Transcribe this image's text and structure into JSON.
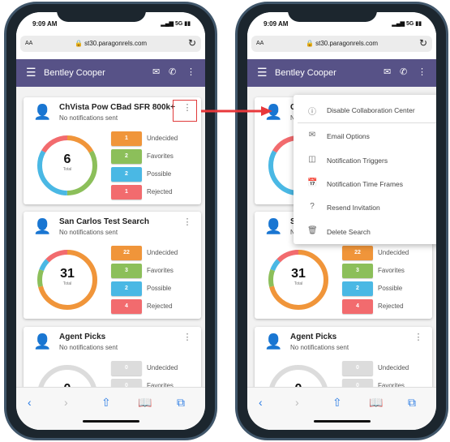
{
  "status": {
    "time": "9:09 AM",
    "signal": "5G"
  },
  "browser": {
    "text_size": "AA",
    "url": "st30.paragonrels.com",
    "icons": [
      "lock-icon",
      "reload-icon",
      "back-icon",
      "forward-icon",
      "share-icon",
      "bookmarks-icon",
      "tabs-icon"
    ]
  },
  "appbar": {
    "title": "Bentley Cooper",
    "icons": [
      "menu-icon",
      "mail-icon",
      "phone-icon",
      "more-icon"
    ]
  },
  "colors": {
    "header": "#575287",
    "undecided": "#f0953a",
    "favorites": "#8cbf5a",
    "possible": "#4ab8e4",
    "rejected": "#f26b6e",
    "empty": "#dcdcdc",
    "highlight": "#e03b3b"
  },
  "cards": [
    {
      "name": "ChVista Pow CBad SFR 800k+",
      "sub": "No notifications sent",
      "total": "6",
      "total_label": "Total",
      "stats": [
        {
          "label": "Undecided",
          "value": 1
        },
        {
          "label": "Favorites",
          "value": 2
        },
        {
          "label": "Possible",
          "value": 2
        },
        {
          "label": "Rejected",
          "value": 1
        }
      ]
    },
    {
      "name": "San Carlos Test Search",
      "sub": "No notifications sent",
      "total": "31",
      "total_label": "Total",
      "stats": [
        {
          "label": "Undecided",
          "value": 22
        },
        {
          "label": "Favorites",
          "value": 3
        },
        {
          "label": "Possible",
          "value": 2
        },
        {
          "label": "Rejected",
          "value": 4
        }
      ]
    },
    {
      "name": "Agent Picks",
      "sub": "No notifications sent",
      "total": "0",
      "total_label": "Total",
      "stats": [
        {
          "label": "Undecided",
          "value": 0
        },
        {
          "label": "Favorites",
          "value": 0
        }
      ]
    }
  ],
  "menu": {
    "items": [
      {
        "label": "Disable Collaboration Center",
        "icon": "info-icon"
      },
      {
        "label": "Email Options",
        "icon": "mail-icon"
      },
      {
        "label": "Notification Triggers",
        "icon": "toggle-icon"
      },
      {
        "label": "Notification Time Frames",
        "icon": "calendar-clock-icon"
      },
      {
        "label": "Resend Invitation",
        "icon": "help-icon"
      },
      {
        "label": "Delete Search",
        "icon": "trash-icon"
      }
    ]
  }
}
